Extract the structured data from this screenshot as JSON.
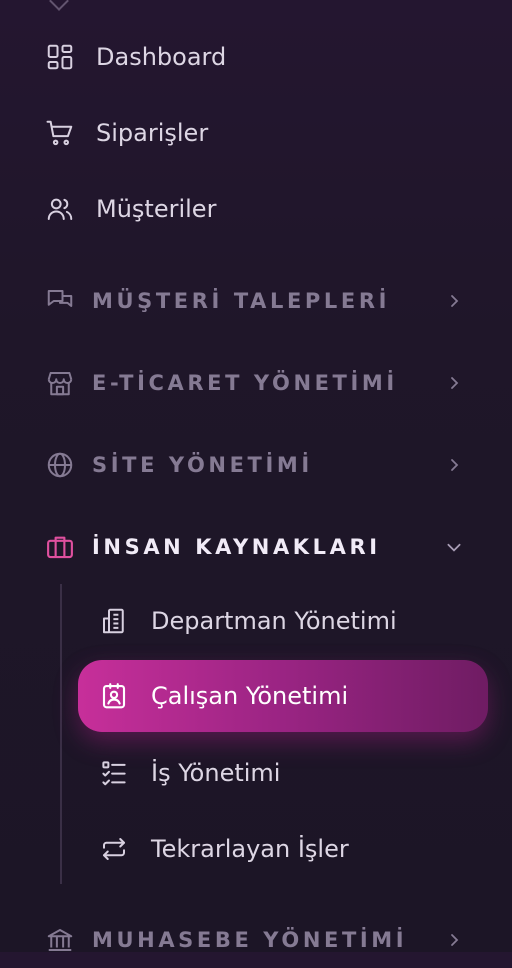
{
  "colors": {
    "background": "#1f1629",
    "text": "#ddd6e4",
    "section_text": "#857a93",
    "accent": "#e0509f",
    "active_gradient_start": "#c72f9a",
    "active_gradient_end": "#6f1c63"
  },
  "nav": {
    "items": [
      {
        "label": "Dashboard",
        "icon": "dashboard-icon"
      },
      {
        "label": "Siparişler",
        "icon": "cart-icon"
      },
      {
        "label": "Müşteriler",
        "icon": "users-icon"
      }
    ],
    "sections": [
      {
        "label": "MÜŞTERİ TALEPLERİ",
        "icon": "chat-icon",
        "expanded": false
      },
      {
        "label": "E-TİCARET YÖNETİMİ",
        "icon": "store-icon",
        "expanded": false
      },
      {
        "label": "SİTE YÖNETİMİ",
        "icon": "globe-icon",
        "expanded": false
      },
      {
        "label": "İNSAN KAYNAKLARI",
        "icon": "briefcase-icon",
        "expanded": true,
        "children": [
          {
            "label": "Departman Yönetimi",
            "icon": "building-icon",
            "active": false
          },
          {
            "label": "Çalışan Yönetimi",
            "icon": "id-badge-icon",
            "active": true
          },
          {
            "label": "İş Yönetimi",
            "icon": "checklist-icon",
            "active": false
          },
          {
            "label": "Tekrarlayan İşler",
            "icon": "repeat-icon",
            "active": false
          }
        ]
      },
      {
        "label": "MUHASEBE YÖNETİMİ",
        "icon": "bank-icon",
        "expanded": false
      }
    ]
  }
}
